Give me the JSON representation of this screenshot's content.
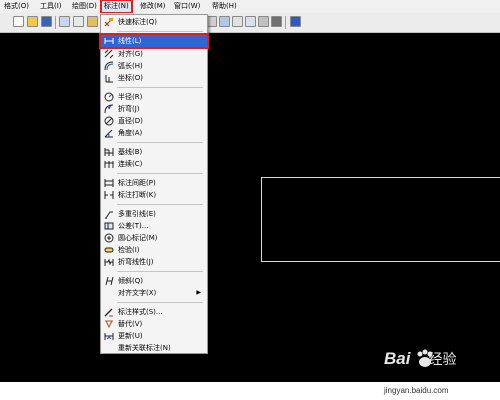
{
  "menubar": {
    "items": [
      {
        "label": "格式(O)"
      },
      {
        "label": "工具(I)"
      },
      {
        "label": "绘图(D)"
      },
      {
        "label": "标注(N)"
      },
      {
        "label": "修改(M)"
      },
      {
        "label": "窗口(W)"
      },
      {
        "label": "帮助(H)"
      }
    ]
  },
  "dimension_menu": {
    "items": [
      {
        "label": "快速标注(Q)",
        "icon": "quick-dimension-icon"
      },
      {
        "label": "线性(L)",
        "icon": "linear-dimension-icon",
        "highlighted": true
      },
      {
        "label": "对齐(G)",
        "icon": "aligned-dimension-icon"
      },
      {
        "label": "弧长(H)",
        "icon": "arc-length-icon"
      },
      {
        "label": "坐标(O)",
        "icon": "ordinate-icon"
      },
      {
        "label": "半径(R)",
        "icon": "radius-icon"
      },
      {
        "label": "折弯(J)",
        "icon": "jogged-icon"
      },
      {
        "label": "直径(D)",
        "icon": "diameter-icon"
      },
      {
        "label": "角度(A)",
        "icon": "angular-icon"
      },
      {
        "label": "基线(B)",
        "icon": "baseline-icon"
      },
      {
        "label": "连续(C)",
        "icon": "continue-icon"
      },
      {
        "label": "标注间距(P)",
        "icon": "dimension-space-icon"
      },
      {
        "label": "标注打断(K)",
        "icon": "dimension-break-icon"
      },
      {
        "label": "多重引线(E)",
        "icon": "multileader-icon"
      },
      {
        "label": "公差(T)...",
        "icon": "tolerance-icon"
      },
      {
        "label": "圆心标记(M)",
        "icon": "center-mark-icon"
      },
      {
        "label": "检验(I)",
        "icon": "inspection-icon"
      },
      {
        "label": "折弯线性(J)",
        "icon": "jogged-linear-icon"
      },
      {
        "label": "倾斜(Q)",
        "icon": "oblique-icon"
      },
      {
        "label": "对齐文字(X)",
        "icon": "",
        "submenu": true
      },
      {
        "label": "标注样式(S)...",
        "icon": "dimension-style-icon"
      },
      {
        "label": "替代(V)",
        "icon": "override-icon"
      },
      {
        "label": "更新(U)",
        "icon": "update-icon"
      },
      {
        "label": "重新关联标注(N)",
        "icon": ""
      }
    ]
  },
  "watermark": {
    "logo_bai": "Bai",
    "logo_jingyan": "经验",
    "site": "jingyan.baidu.com"
  },
  "colors": {
    "highlight": "#2f66d4",
    "annotation_red": "#e02020",
    "canvas": "#000000"
  }
}
